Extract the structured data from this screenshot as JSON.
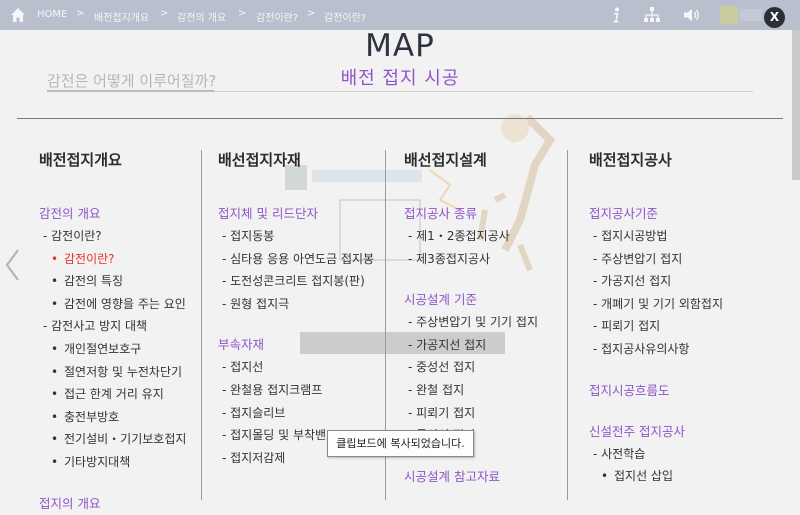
{
  "breadcrumb": {
    "home": "HOME",
    "items": [
      "배전접지개요",
      "감전의 개요",
      "감전이란?",
      "감전이란?"
    ]
  },
  "background": {
    "question": "감전은 어떻게 이루어질까?"
  },
  "map": {
    "title": "MAP",
    "subtitle": "배전 접지 시공",
    "close_label": "X",
    "columns": [
      {
        "header": "배전접지개요",
        "sections": [
          {
            "title": "감전의 개요",
            "items": [
              {
                "label": "- 감전이란?",
                "subs": [
                  {
                    "label": "감전이란?",
                    "active": true
                  },
                  {
                    "label": "감전의 특징",
                    "active": false
                  },
                  {
                    "label": "감전에 영향을 주는 요인",
                    "active": false
                  }
                ]
              },
              {
                "label": "- 감전사고 방지 대책",
                "subs": [
                  {
                    "label": "개인절연보호구",
                    "active": false
                  },
                  {
                    "label": "절연저항 및 누전차단기",
                    "active": false
                  },
                  {
                    "label": "접근 한계 거리 유지",
                    "active": false
                  },
                  {
                    "label": "충전부방호",
                    "active": false
                  },
                  {
                    "label": "전기설비・기기보호접지",
                    "active": false
                  },
                  {
                    "label": "기타방지대책",
                    "active": false
                  }
                ]
              }
            ]
          },
          {
            "title": "접지의 개요",
            "items": []
          }
        ]
      },
      {
        "header": "배선접지자재",
        "sections": [
          {
            "title": "접지체 및 리드단자",
            "items": [
              {
                "label": "- 접지동봉",
                "subs": []
              },
              {
                "label": "- 심타용 응용 아연도금 접지봉",
                "subs": []
              },
              {
                "label": "- 도전성콘크리트 접지봉(판)",
                "subs": []
              },
              {
                "label": "- 원형 접지극",
                "subs": []
              }
            ]
          },
          {
            "title": "부속자재",
            "items": [
              {
                "label": "- 접지선",
                "subs": []
              },
              {
                "label": "- 완철용 접지크램프",
                "subs": []
              },
              {
                "label": "- 접지슬리브",
                "subs": []
              },
              {
                "label": "- 접지몰딩 및 부착밴드",
                "subs": []
              },
              {
                "label": "- 접지저감제",
                "subs": []
              }
            ]
          }
        ]
      },
      {
        "header": "배선접지설계",
        "sections": [
          {
            "title": "접지공사 종류",
            "items": [
              {
                "label": "- 제1・2종접지공사",
                "subs": []
              },
              {
                "label": "- 제3종접지공사",
                "subs": []
              }
            ]
          },
          {
            "title": "시공설계 기준",
            "items": [
              {
                "label": "- 주상변압기 및 기기 접지",
                "subs": []
              },
              {
                "label": "- 가공지선 접지",
                "subs": []
              },
              {
                "label": "- 중성선 접지",
                "subs": []
              },
              {
                "label": "- 완철 접지",
                "subs": []
              },
              {
                "label": "- 피뢰기 접지",
                "subs": []
              },
              {
                "label": "- 통신선 접지",
                "subs": []
              }
            ]
          },
          {
            "title": "시공설계 참고자료",
            "items": []
          }
        ]
      },
      {
        "header": "배전접지공사",
        "sections": [
          {
            "title": "접지공사기준",
            "items": [
              {
                "label": "- 접지시공방법",
                "subs": []
              },
              {
                "label": "- 주상변압기 접지",
                "subs": []
              },
              {
                "label": "- 가공지선 접지",
                "subs": []
              },
              {
                "label": "- 개폐기 및 기기 외함접지",
                "subs": []
              },
              {
                "label": "- 피뢰기 접지",
                "subs": []
              },
              {
                "label": "- 접지공사유의사항",
                "subs": []
              }
            ]
          },
          {
            "title": "접지시공흐름도",
            "items": []
          },
          {
            "title": "신설전주 접지공사",
            "items": [
              {
                "label": "- 사전학습",
                "subs": [
                  {
                    "label": "접지선 삽입",
                    "active": false
                  }
                ]
              }
            ]
          }
        ]
      }
    ]
  },
  "toast": "클립보드에 복사되었습니다.",
  "colors": {
    "accent": "#8d55c9",
    "active": "#e8322b",
    "background": "#f2f2f2"
  }
}
